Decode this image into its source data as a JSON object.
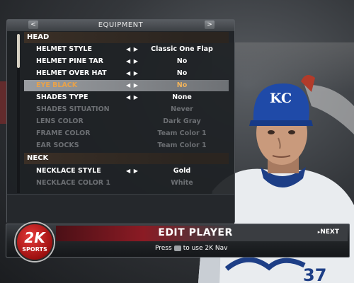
{
  "panel": {
    "title": "EQUIPMENT",
    "prev_icon": "<",
    "next_icon": ">"
  },
  "sections": {
    "head": "HEAD",
    "neck": "NECK"
  },
  "rows": [
    {
      "label": "HELMET STYLE",
      "value": "Classic One Flap",
      "state": "enabled",
      "arrows": "◀ ▶"
    },
    {
      "label": "HELMET PINE TAR",
      "value": "No",
      "state": "enabled",
      "arrows": "◀ ▶"
    },
    {
      "label": "HELMET OVER HAT",
      "value": "No",
      "state": "enabled",
      "arrows": "◀ ▶"
    },
    {
      "label": "EYE BLACK",
      "value": "No",
      "state": "selected",
      "arrows": "◀ ▶"
    },
    {
      "label": "SHADES TYPE",
      "value": "None",
      "state": "enabled",
      "arrows": "◀ ▶"
    },
    {
      "label": "SHADES SITUATION",
      "value": "Never",
      "state": "disabled",
      "arrows": ""
    },
    {
      "label": "LENS COLOR",
      "value": "Dark Gray",
      "state": "disabled",
      "arrows": ""
    },
    {
      "label": "FRAME COLOR",
      "value": "Team Color 1",
      "state": "disabled",
      "arrows": ""
    },
    {
      "label": "EAR SOCKS",
      "value": "Team Color 1",
      "state": "disabled",
      "arrows": ""
    },
    {
      "label": "NECKLACE STYLE",
      "value": "Gold",
      "state": "enabled",
      "arrows": "◀ ▶"
    },
    {
      "label": "NECKLACE COLOR 1",
      "value": "White",
      "state": "disabled",
      "arrows": ""
    }
  ],
  "bottom_bar": {
    "title": "EDIT PLAYER",
    "next_label": "NEXT",
    "next_icon": "▸",
    "hint_prefix": "Press",
    "hint_suffix": "to use 2K Nav"
  },
  "logo": {
    "brand": "2K",
    "sub": "SPORTS"
  },
  "player": {
    "helmet_letters": "KC",
    "jersey_number": "37",
    "colors": {
      "helmet": "#1f4aa8",
      "jersey": "#e9ecef",
      "skin": "#c99a7c"
    }
  },
  "colors": {
    "accent_selected": "#f4b55a",
    "section_bg": "#3a2f26",
    "brand_red": "#b31b1b"
  }
}
